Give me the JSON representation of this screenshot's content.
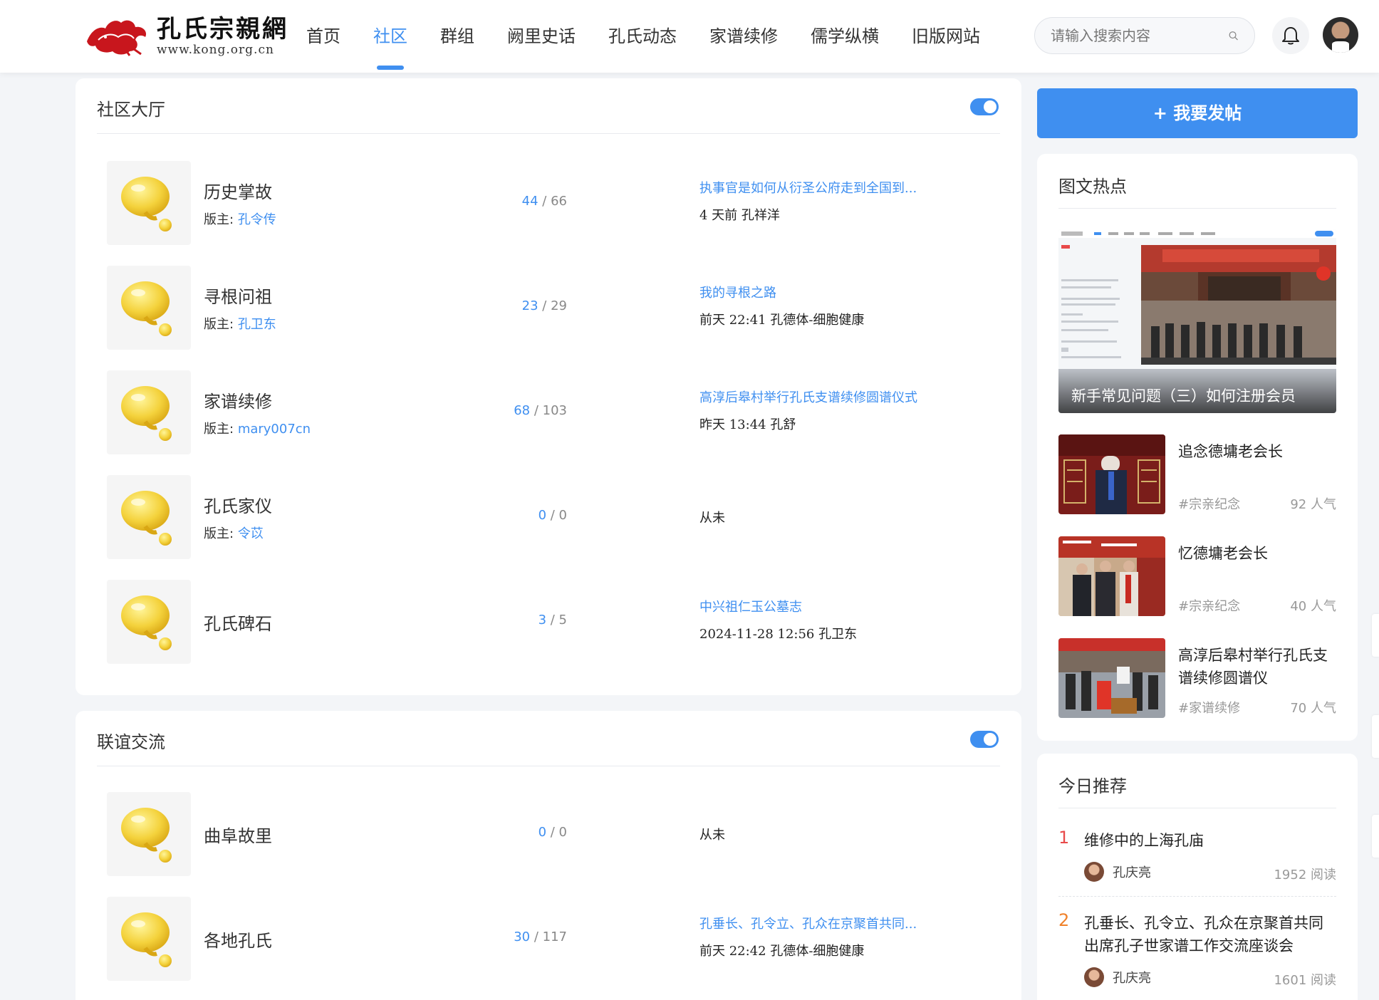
{
  "header": {
    "logo": {
      "title": "孔氏宗親網",
      "url": "www.kong.org.cn"
    },
    "nav": [
      "首页",
      "社区",
      "群组",
      "阙里史话",
      "孔氏动态",
      "家谱续修",
      "儒学纵横",
      "旧版网站"
    ],
    "active_nav": "社区",
    "search": {
      "placeholder": "请输入搜索内容",
      "value": ""
    }
  },
  "sections": [
    {
      "title": "社区大厅",
      "forums": [
        {
          "name": "历史掌故",
          "mod_label": "版主:",
          "moderator": "孔令传",
          "topics": "44",
          "posts": "66",
          "last_title": "执事官是如何从衍圣公府走到全国到...",
          "last_meta": "4 天前 孔祥洋"
        },
        {
          "name": "寻根问祖",
          "mod_label": "版主:",
          "moderator": "孔卫东",
          "topics": "23",
          "posts": "29",
          "last_title": "我的寻根之路",
          "last_meta": "前天 22:41 孔德体-细胞健康"
        },
        {
          "name": "家谱续修",
          "mod_label": "版主:",
          "moderator": "mary007cn",
          "topics": "68",
          "posts": "103",
          "last_title": "高淳后皋村举行孔氏支谱续修圆谱仪式",
          "last_meta": "昨天 13:44 孔舒"
        },
        {
          "name": "孔氏家仪",
          "mod_label": "版主:",
          "moderator": "令苡",
          "topics": "0",
          "posts": "0",
          "last_only": "从未"
        },
        {
          "name": "孔氏碑石",
          "topics": "3",
          "posts": "5",
          "last_title": "中兴祖仁玉公墓志",
          "last_meta": "2024-11-28 12:56 孔卫东"
        }
      ]
    },
    {
      "title": "联谊交流",
      "forums": [
        {
          "name": "曲阜故里",
          "topics": "0",
          "posts": "0",
          "last_only": "从未"
        },
        {
          "name": "各地孔氏",
          "topics": "30",
          "posts": "117",
          "last_title": "孔垂长、孔令立、孔众在京聚首共同...",
          "last_meta": "前天 22:42 孔德体-细胞健康"
        }
      ]
    }
  ],
  "sidebar": {
    "post_button": "+ 我要发帖",
    "hot": {
      "title": "图文热点",
      "hero_caption": "新手常见问题（三）如何注册会员",
      "items": [
        {
          "title": "追念德墉老会长",
          "tag": "#宗亲纪念",
          "views": "92 人气"
        },
        {
          "title": "忆德墉老会长",
          "tag": "#宗亲纪念",
          "views": "40 人气"
        },
        {
          "title": "高淳后皋村举行孔氏支谱续修圆谱仪",
          "tag": "#家谱续修",
          "views": "70 人气"
        }
      ]
    },
    "recommend": {
      "title": "今日推荐",
      "items": [
        {
          "rank": "1",
          "rank_color": "#e84a4a",
          "title": "维修中的上海孔庙",
          "author": "孔庆亮",
          "views": "1952 阅读"
        },
        {
          "rank": "2",
          "rank_color": "#f0812a",
          "title": "孔垂长、孔令立、孔众在京聚首共同出席孔子世家谱工作交流座谈会",
          "author": "孔庆亮",
          "views": "1601 阅读"
        }
      ]
    }
  },
  "colors": {
    "accent": "#3f8ff0",
    "rank1": "#e84a4a",
    "rank2": "#f0812a"
  }
}
